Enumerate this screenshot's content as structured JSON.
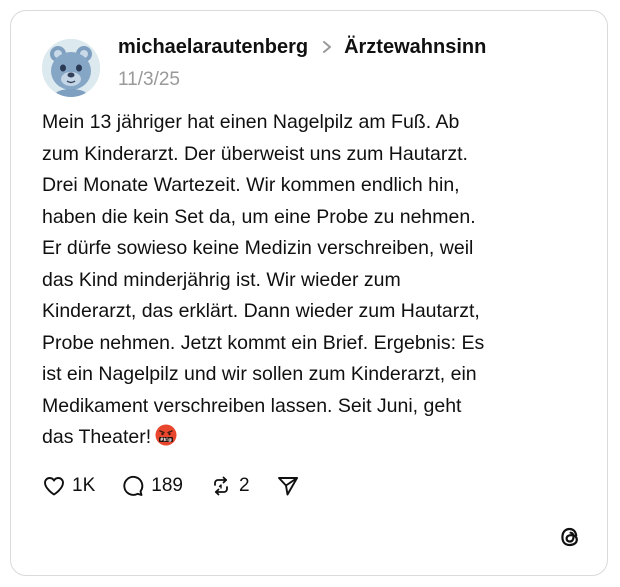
{
  "post": {
    "username": "michaelarautenberg",
    "community": "Ärztewahnsinn",
    "date": "11/3/25",
    "text_lines": [
      "Mein 13 jähriger hat einen Nagelpilz am Fuß. Ab",
      "zum Kinderarzt. Der überweist uns zum Hautarzt.",
      "Drei Monate Wartezeit. Wir kommen endlich hin,",
      "haben die kein Set da, um eine Probe zu nehmen.",
      "Er dürfe sowieso keine Medizin verschreiben, weil",
      "das Kind minderjährig ist. Wir wieder zum",
      "Kinderarzt, das erklärt. Dann wieder zum Hautarzt,",
      "Probe nehmen. Jetzt kommt ein Brief. Ergebnis: Es",
      "ist ein Nagelpilz und wir sollen zum Kinderarzt, ein",
      "Medikament verschreiben lassen. Seit Juni, geht",
      "das Theater!"
    ],
    "emoji": "face-with-symbols-on-mouth",
    "emoji_censor_text": "#$!@"
  },
  "actions": {
    "likes": "1K",
    "replies": "189",
    "reposts": "2"
  },
  "icons": {
    "avatar": "blue-bear-avatar",
    "separator": "chevron-right-icon",
    "like": "heart-icon",
    "reply": "comment-bubble-icon",
    "repost": "repost-icon",
    "share": "send-icon",
    "brand": "threads-logo-icon"
  },
  "colors": {
    "text": "#101010",
    "muted": "#999999",
    "border": "#dadada",
    "emoji_face": "#e8472e"
  }
}
